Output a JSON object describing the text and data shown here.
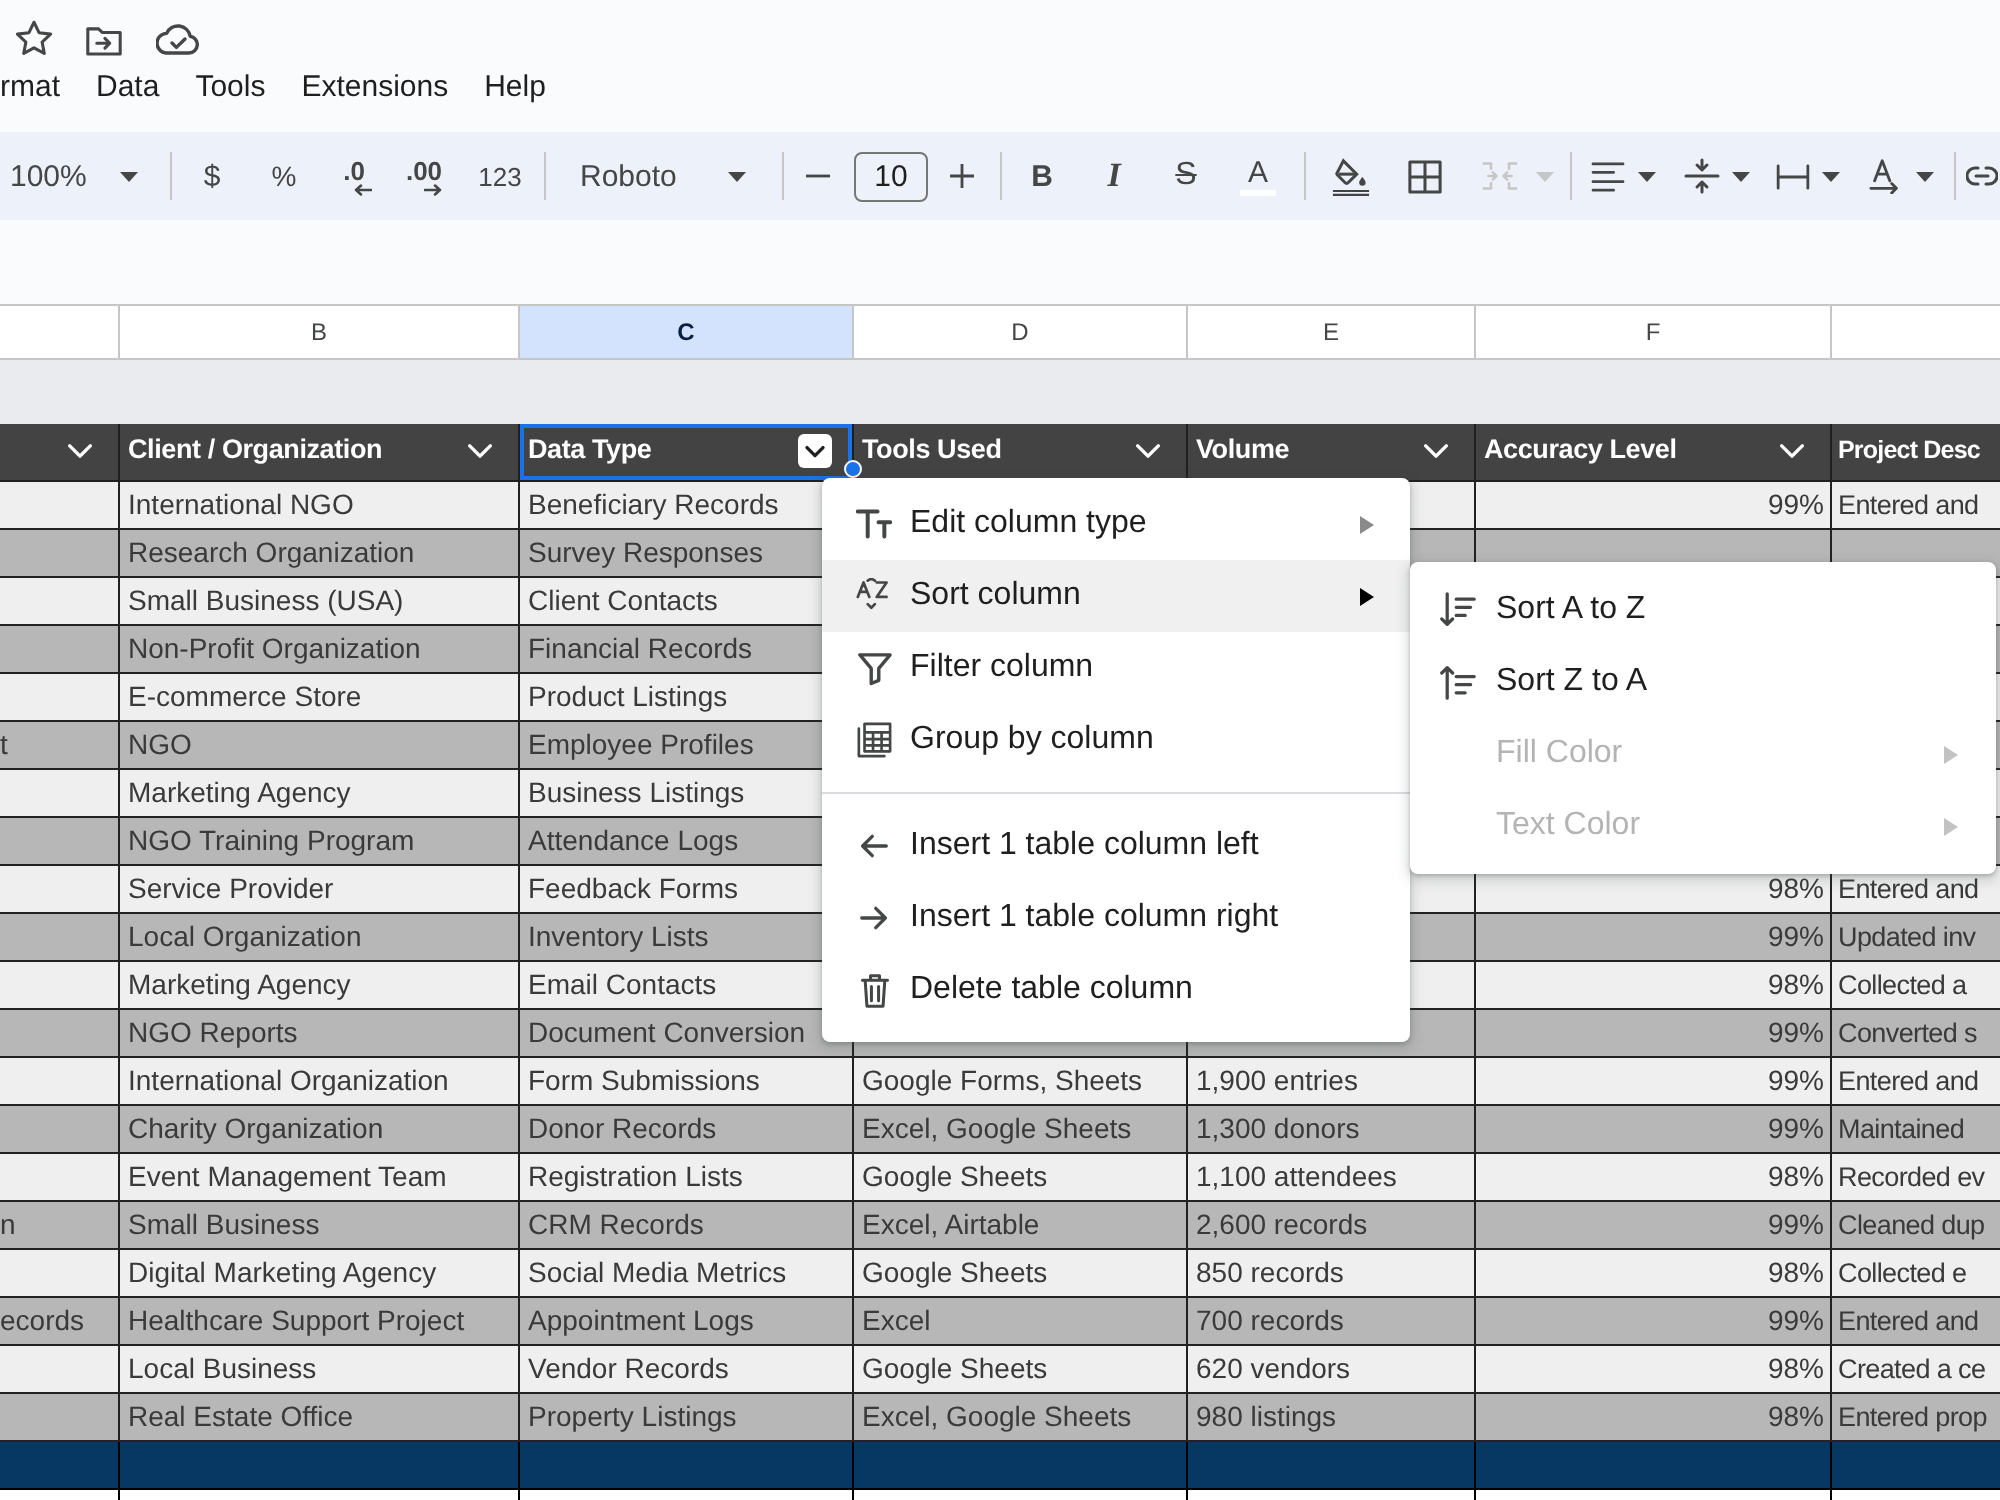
{
  "menu_bar": [
    "rmat",
    "Data",
    "Tools",
    "Extensions",
    "Help"
  ],
  "toolbar": {
    "zoom": "100%",
    "currency": "$",
    "percent": "%",
    "decrease_decimal": ".0",
    "increase_decimal": ".00",
    "more_formats": "123",
    "font": "Roboto",
    "font_size": "10",
    "bold": "B",
    "italic": "I",
    "strikethrough": "S",
    "text_color": "A",
    "merge_cells": {
      "disabled": true
    }
  },
  "table": {
    "columns": [
      {
        "dropdown": true,
        "selected": false
      },
      {
        "letter": "B",
        "header": "Client / Organization",
        "dropdown": true,
        "selected": false
      },
      {
        "letter": "C",
        "header": "Data Type",
        "dropdown": true,
        "selected": true
      },
      {
        "letter": "D",
        "header": "Tools Used",
        "dropdown": true,
        "selected": false
      },
      {
        "letter": "E",
        "header": "Volume",
        "dropdown": true,
        "selected": false
      },
      {
        "letter": "F",
        "header": "Accuracy Level",
        "dropdown": true,
        "selected": false
      },
      {
        "header": "Project Desc",
        "dropdown": false,
        "selected": false
      }
    ],
    "rows": [
      {
        "client_organization": "International NGO",
        "data_type": "Beneficiary Records",
        "accuracy_level": "99%",
        "project_desc": "Entered and"
      },
      {
        "client_organization": "Research Organization",
        "data_type": "Survey Responses"
      },
      {
        "client_organization": "Small Business (USA)",
        "data_type": "Client Contacts"
      },
      {
        "client_organization": "Non-Profit Organization",
        "data_type": "Financial Records"
      },
      {
        "client_organization": "E-commerce Store",
        "data_type": "Product Listings"
      },
      {
        "column_a": "t",
        "client_organization": "NGO",
        "data_type": "Employee Profiles"
      },
      {
        "client_organization": "Marketing Agency",
        "data_type": "Business Listings"
      },
      {
        "client_organization": "NGO Training Program",
        "data_type": "Attendance Logs"
      },
      {
        "client_organization": "Service Provider",
        "data_type": "Feedback Forms",
        "accuracy_level": "98%",
        "project_desc": "Entered and"
      },
      {
        "client_organization": "Local Organization",
        "data_type": "Inventory Lists",
        "accuracy_level": "99%",
        "project_desc": "Updated inv"
      },
      {
        "client_organization": "Marketing Agency",
        "data_type": "Email Contacts",
        "accuracy_level": "98%",
        "project_desc": "Collected a"
      },
      {
        "client_organization": "NGO Reports",
        "data_type": "Document Conversion",
        "accuracy_level": "99%",
        "project_desc": "Converted s"
      },
      {
        "client_organization": "International Organization",
        "data_type": "Form Submissions",
        "tools_used": "Google Forms, Sheets",
        "volume": "1,900 entries",
        "accuracy_level": "99%",
        "project_desc": "Entered and"
      },
      {
        "client_organization": "Charity Organization",
        "data_type": "Donor Records",
        "tools_used": "Excel, Google Sheets",
        "volume": "1,300 donors",
        "accuracy_level": "99%",
        "project_desc": "Maintained"
      },
      {
        "client_organization": "Event Management Team",
        "data_type": "Registration Lists",
        "tools_used": "Google Sheets",
        "volume": "1,100 attendees",
        "accuracy_level": "98%",
        "project_desc": "Recorded ev"
      },
      {
        "column_a": "n",
        "client_organization": "Small Business",
        "data_type": "CRM Records",
        "tools_used": "Excel, Airtable",
        "volume": "2,600 records",
        "accuracy_level": "99%",
        "project_desc": "Cleaned dup"
      },
      {
        "client_organization": "Digital Marketing Agency",
        "data_type": "Social Media Metrics",
        "tools_used": "Google Sheets",
        "volume": "850 records",
        "accuracy_level": "98%",
        "project_desc": "Collected e"
      },
      {
        "column_a": "ecords",
        "client_organization": "Healthcare Support Project",
        "data_type": "Appointment Logs",
        "tools_used": "Excel",
        "volume": "700 records",
        "accuracy_level": "99%",
        "project_desc": "Entered and"
      },
      {
        "client_organization": "Local Business",
        "data_type": "Vendor Records",
        "tools_used": "Google Sheets",
        "volume": "620 vendors",
        "accuracy_level": "98%",
        "project_desc": "Created a ce"
      },
      {
        "client_organization": "Real Estate Office",
        "data_type": "Property Listings",
        "tools_used": "Excel, Google Sheets",
        "volume": "980 listings",
        "accuracy_level": "98%",
        "project_desc": "Entered prop"
      }
    ]
  },
  "column_menu": {
    "items": [
      {
        "kind": "item",
        "label": "Edit column type",
        "has_submenu": true,
        "highlighted": false
      },
      {
        "kind": "item",
        "label": "Sort column",
        "has_submenu": true,
        "highlighted": true
      },
      {
        "kind": "item",
        "label": "Filter column",
        "has_submenu": false,
        "highlighted": false
      },
      {
        "kind": "item",
        "label": "Group by column",
        "has_submenu": false,
        "highlighted": false
      },
      {
        "kind": "divider"
      },
      {
        "kind": "item",
        "label": "Insert 1 table column left",
        "has_submenu": false,
        "highlighted": false
      },
      {
        "kind": "item",
        "label": "Insert 1 table column right",
        "has_submenu": false,
        "highlighted": false
      },
      {
        "kind": "item",
        "label": "Delete table column",
        "has_submenu": false,
        "highlighted": false
      }
    ],
    "submenu": {
      "items": [
        {
          "label": "Sort A to Z",
          "disabled": false,
          "has_submenu": false
        },
        {
          "label": "Sort Z to A",
          "disabled": false,
          "has_submenu": false
        },
        {
          "label": "Fill Color",
          "disabled": true,
          "has_submenu": true
        },
        {
          "label": "Text Color",
          "disabled": true,
          "has_submenu": true
        }
      ]
    }
  }
}
